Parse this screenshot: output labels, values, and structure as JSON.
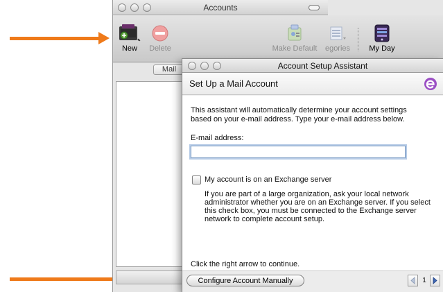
{
  "accounts_window": {
    "title": "Accounts",
    "toolbar": {
      "new_label": "New",
      "delete_label": "Delete",
      "make_default_label": "Make Default",
      "categories_label": "egories",
      "my_day_label": "My Day"
    },
    "tabs": [
      {
        "label": "Mail"
      }
    ]
  },
  "setup_assistant": {
    "title": "Account Setup Assistant",
    "heading": "Set Up a Mail Account",
    "intro_line1": "This assistant will automatically determine your account settings",
    "intro_line2": "based on your e-mail address. Type your e-mail address below.",
    "email_label": "E-mail address:",
    "email_value": "",
    "exchange_checkbox_label": "My account is on an Exchange server",
    "exchange_checked": false,
    "exchange_help_lines": [
      "If you are part of a large organization, ask your local network",
      "administrator whether you are on an Exchange server. If you select",
      "this check box, you must be connected to the Exchange server",
      "network to complete account setup."
    ],
    "continue_hint": "Click the right arrow to continue.",
    "configure_manually_label": "Configure Account Manually",
    "page_number": "1"
  },
  "annotation": {
    "arrow_color": "#ef7a1a"
  }
}
